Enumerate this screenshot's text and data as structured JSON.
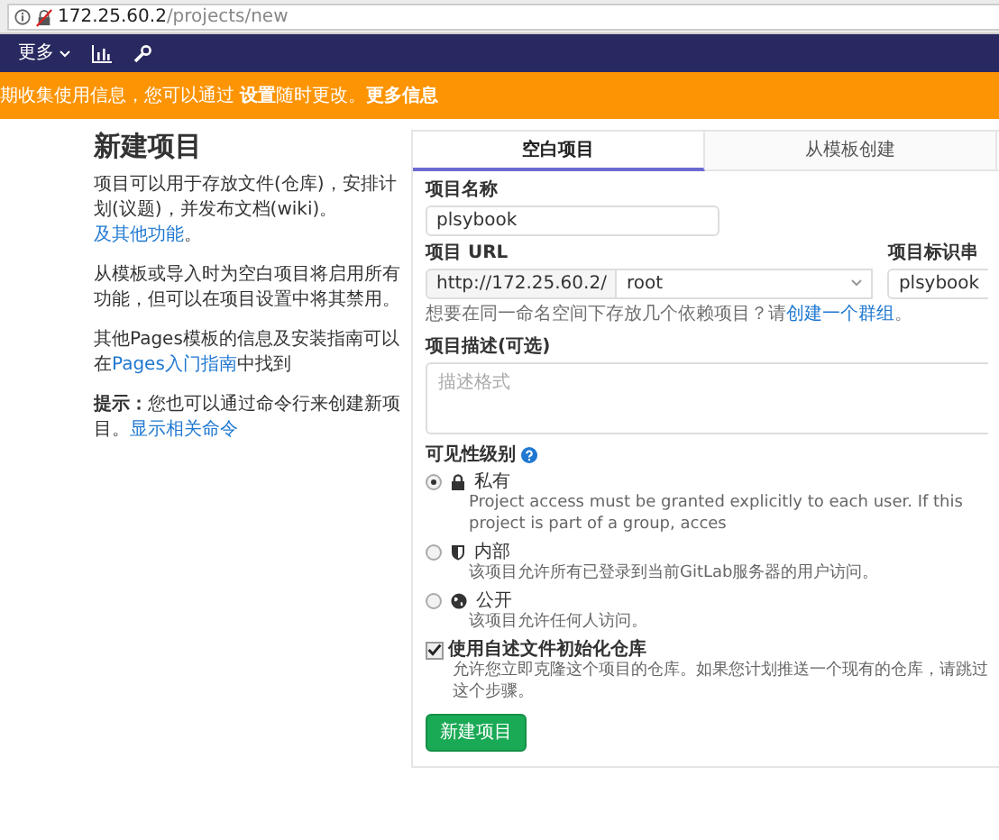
{
  "browser": {
    "host": "172.25.60.2",
    "path": "/projects/new"
  },
  "navbar": {
    "more": "更多"
  },
  "banner": {
    "parts": [
      {
        "kind": "text",
        "text": "期收集使用信息，您可以通过 "
      },
      {
        "kind": "link",
        "text": "设置"
      },
      {
        "kind": "text",
        "text": "随时更改。"
      },
      {
        "kind": "link",
        "text": "更多信息"
      }
    ]
  },
  "intro": {
    "title": "新建项目",
    "paragraphs": [
      [
        {
          "kind": "text",
          "text": "项目可以用于存放文件(仓库)，安排计划(议题)，并发布文档(wiki)。"
        },
        {
          "kind": "link",
          "text": "及其他功能"
        },
        {
          "kind": "text",
          "text": "。"
        }
      ],
      [
        {
          "kind": "text",
          "text": "从模板或导入时为空白项目将启用所有功能，但可以在项目设置中将其禁用。"
        }
      ],
      [
        {
          "kind": "text",
          "text": "其他Pages模板的信息及安装指南可以在"
        },
        {
          "kind": "link",
          "text": "Pages入门指南"
        },
        {
          "kind": "text",
          "text": "中找到"
        }
      ],
      [
        {
          "kind": "bold",
          "text": "提示："
        },
        {
          "kind": "text",
          "text": "您也可以通过命令行来创建新项目。"
        },
        {
          "kind": "link",
          "text": "显示相关命令"
        }
      ]
    ]
  },
  "tabs": [
    {
      "label": "空白项目",
      "selected": true
    },
    {
      "label": "从模板创建",
      "selected": false
    }
  ],
  "form": {
    "name": {
      "label": "项目名称",
      "value": "plsybook"
    },
    "url": {
      "label": "项目 URL",
      "prefix": "http://172.25.60.2/",
      "namespace": "root"
    },
    "slug": {
      "label": "项目标识串",
      "value": "plsybook"
    },
    "hint": [
      {
        "kind": "text",
        "text": "想要在同一命名空间下存放几个依赖项目？请"
      },
      {
        "kind": "link",
        "text": "创建一个群组"
      },
      {
        "kind": "text",
        "text": "。"
      }
    ],
    "description": {
      "label": "项目描述(可选)",
      "placeholder": "描述格式"
    },
    "visibility": {
      "label": "可见性级别",
      "options": [
        {
          "kind": "private",
          "label": "私有",
          "description": "Project access must be granted explicitly to each user. If this project is part of a group, acces",
          "selected": true
        },
        {
          "kind": "internal",
          "label": "内部",
          "description": "该项目允许所有已登录到当前GitLab服务器的用户访问。",
          "selected": false
        },
        {
          "kind": "public",
          "label": "公开",
          "description": "该项目允许任何人访问。",
          "selected": false
        }
      ]
    },
    "readme": {
      "label": "使用自述文件初始化仓库",
      "description": "允许您立即克隆这个项目的仓库。如果您计划推送一个现有的仓库，请跳过这个步骤。",
      "checked": true
    },
    "submit": "新建项目"
  }
}
